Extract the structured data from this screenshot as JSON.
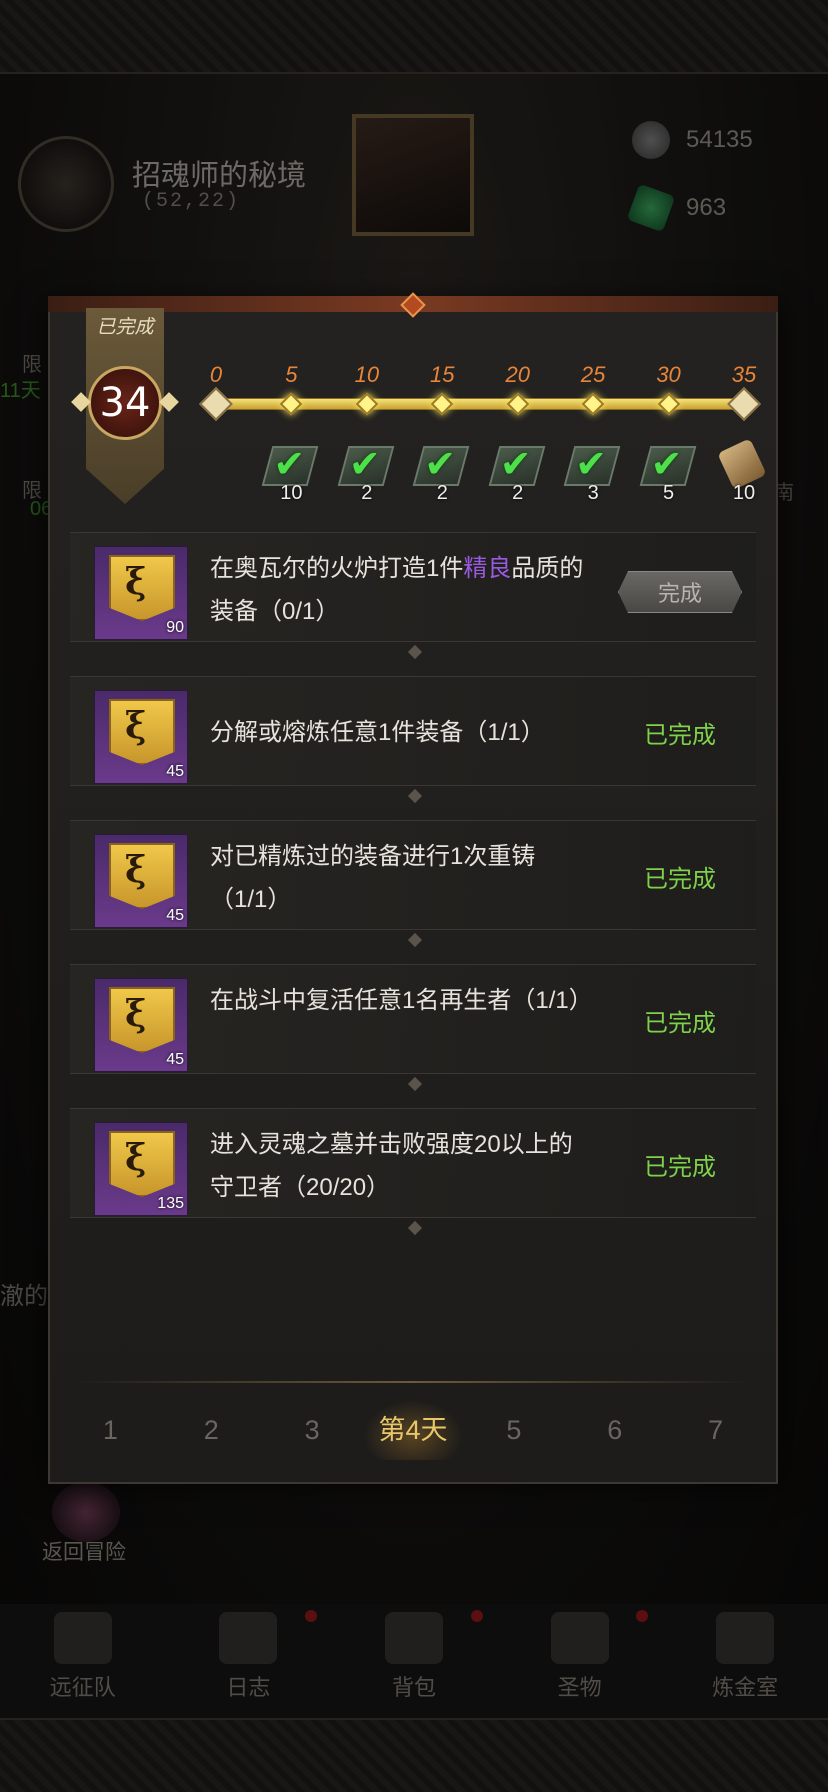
{
  "colors": {
    "accent_gold": "#e8c66a",
    "done_green": "#7ed24a",
    "highlight_purple": "#9a5ae0",
    "progress_orange": "#e8853a"
  },
  "location": {
    "title": "招魂师的秘境",
    "coords": "(52,22)"
  },
  "resources": [
    {
      "icon": "ore-icon",
      "value": "54135"
    },
    {
      "icon": "emerald-icon",
      "value": "963"
    }
  ],
  "background_side_text": {
    "left_a": "限",
    "left_b": "11天",
    "left_c": "限",
    "left_d": "06",
    "right_a": "南",
    "overflow_text": "澈的"
  },
  "return": {
    "label": "返回冒险"
  },
  "nav": [
    {
      "label": "远征队",
      "icon": "helmet-icon"
    },
    {
      "label": "日志",
      "icon": "journal-icon"
    },
    {
      "label": "背包",
      "icon": "backpack-icon"
    },
    {
      "label": "圣物",
      "icon": "relic-icon"
    },
    {
      "label": "炼金室",
      "icon": "alchemy-icon"
    }
  ],
  "panel": {
    "badge_label": "已完成",
    "badge_value": "34",
    "progress": {
      "current": 34,
      "max": 35,
      "milestones": [
        "0",
        "5",
        "10",
        "15",
        "20",
        "25",
        "30",
        "35"
      ],
      "rewards": [
        {
          "count": "10",
          "claimed": true
        },
        {
          "count": "2",
          "claimed": true
        },
        {
          "count": "2",
          "claimed": true
        },
        {
          "count": "2",
          "claimed": true
        },
        {
          "count": "3",
          "claimed": true
        },
        {
          "count": "5",
          "claimed": true
        },
        {
          "count": "10",
          "claimed": false
        }
      ]
    },
    "tasks": [
      {
        "points": "90",
        "desc_pre": "在奥瓦尔的火炉打造1件",
        "desc_hl": "精良",
        "desc_post": "品质的装备（0/1）",
        "status": "完成",
        "done": false
      },
      {
        "points": "45",
        "desc_pre": "分解或熔炼任意1件装备（1/1）",
        "desc_hl": "",
        "desc_post": "",
        "status": "已完成",
        "done": true
      },
      {
        "points": "45",
        "desc_pre": "对已精炼过的装备进行1次重铸（1/1）",
        "desc_hl": "",
        "desc_post": "",
        "status": "已完成",
        "done": true
      },
      {
        "points": "45",
        "desc_pre": "在战斗中复活任意1名再生者（1/1）",
        "desc_hl": "",
        "desc_post": "",
        "status": "已完成",
        "done": true
      },
      {
        "points": "135",
        "desc_pre": "进入灵魂之墓并击败强度20以上的守卫者（20/20）",
        "desc_hl": "",
        "desc_post": "",
        "status": "已完成",
        "done": true
      }
    ],
    "day_tabs": [
      "1",
      "2",
      "3",
      "第4天",
      "5",
      "6",
      "7"
    ],
    "active_day": 3
  }
}
